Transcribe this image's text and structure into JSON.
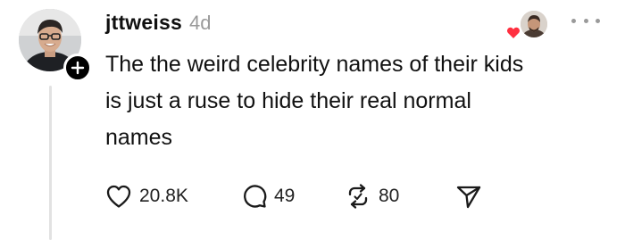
{
  "post": {
    "username": "jttweiss",
    "timestamp": "4d",
    "text_lines": [
      "The the weird celebrity names of their kids",
      "is just a ruse to hide their real normal",
      "names"
    ]
  },
  "actions": {
    "likes": "20.8K",
    "replies": "49",
    "reposts": "80"
  },
  "icons": {
    "follow": "plus-icon",
    "like": "heart-icon",
    "reply": "comment-icon",
    "repost": "repost-icon",
    "share": "send-icon",
    "more": "more-icon"
  },
  "colors": {
    "text": "#111111",
    "muted": "#9a9a9a",
    "heart": "#ff3040"
  }
}
